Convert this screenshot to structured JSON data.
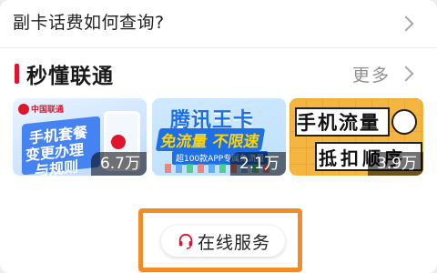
{
  "faq": {
    "question": "副卡话费如何查询?"
  },
  "section": {
    "title": "秒懂联通",
    "more_label": "更多"
  },
  "videos": [
    {
      "title_lines": [
        "手机套餐",
        "变更办理",
        "与规则"
      ],
      "logo_text": "中国联通",
      "views": "6.7万"
    },
    {
      "title_lines": [
        "腾讯王卡",
        "免流量 不限速",
        "超100款APP专属免流量"
      ],
      "views": "2.1万"
    },
    {
      "title_lines": [
        "手机流量",
        "抵扣顺序"
      ],
      "views": "3.9万"
    }
  ],
  "service": {
    "label": "在线服务",
    "icon": "headset-icon"
  },
  "colors": {
    "accent": "#e0142b",
    "highlight": "#f28c28"
  }
}
